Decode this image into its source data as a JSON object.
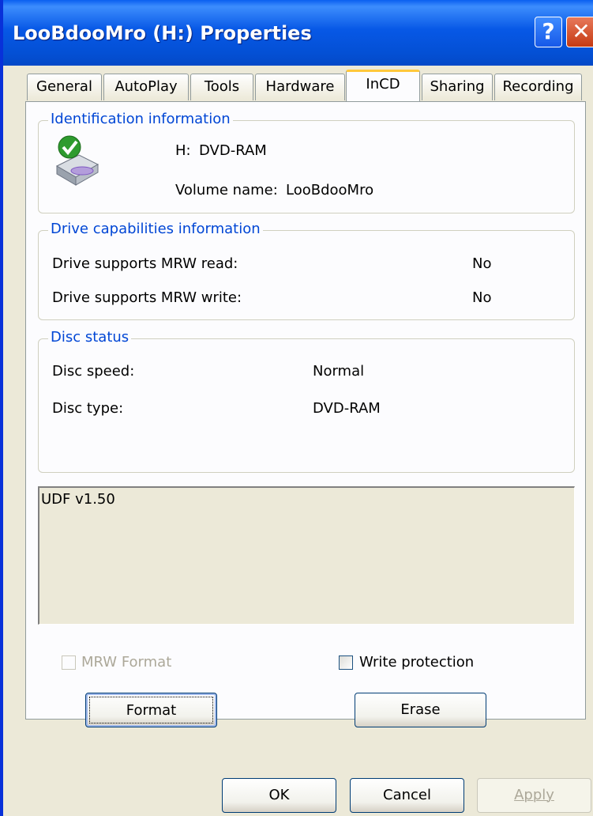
{
  "window": {
    "title": "LooBdooMro (H:) Properties",
    "help_glyph": "?",
    "close_glyph": "✕"
  },
  "tabs": [
    {
      "label": "General"
    },
    {
      "label": "AutoPlay"
    },
    {
      "label": "Tools"
    },
    {
      "label": "Hardware"
    },
    {
      "label": "InCD",
      "active": true
    },
    {
      "label": "Sharing"
    },
    {
      "label": "Recording"
    }
  ],
  "identification": {
    "legend": "Identification information",
    "drive_letter": "H:",
    "drive_type": "DVD-RAM",
    "volume_label": "Volume name:",
    "volume_name": "LooBdooMro",
    "icon": "dvd-drive-icon"
  },
  "capabilities": {
    "legend": "Drive capabilities information",
    "rows": [
      {
        "label": "Drive supports MRW read:",
        "value": "No"
      },
      {
        "label": "Drive supports MRW write:",
        "value": "No"
      }
    ]
  },
  "disc_status": {
    "legend": "Disc status",
    "rows": [
      {
        "label": "Disc speed:",
        "value": "Normal"
      },
      {
        "label": "Disc type:",
        "value": "DVD-RAM"
      }
    ]
  },
  "info_box": {
    "text": "UDF v1.50"
  },
  "options": {
    "mrw_format": {
      "label": "MRW Format",
      "checked": false,
      "enabled": false
    },
    "write_protection": {
      "label": "Write protection",
      "checked": false,
      "enabled": true
    }
  },
  "actions": {
    "format": "Format",
    "erase": "Erase"
  },
  "footer": {
    "ok": "OK",
    "cancel": "Cancel",
    "apply": "Apply"
  },
  "colors": {
    "accent": "#0046d5",
    "titlebar": "#0450d5",
    "tab_highlight": "#ffc83c"
  }
}
